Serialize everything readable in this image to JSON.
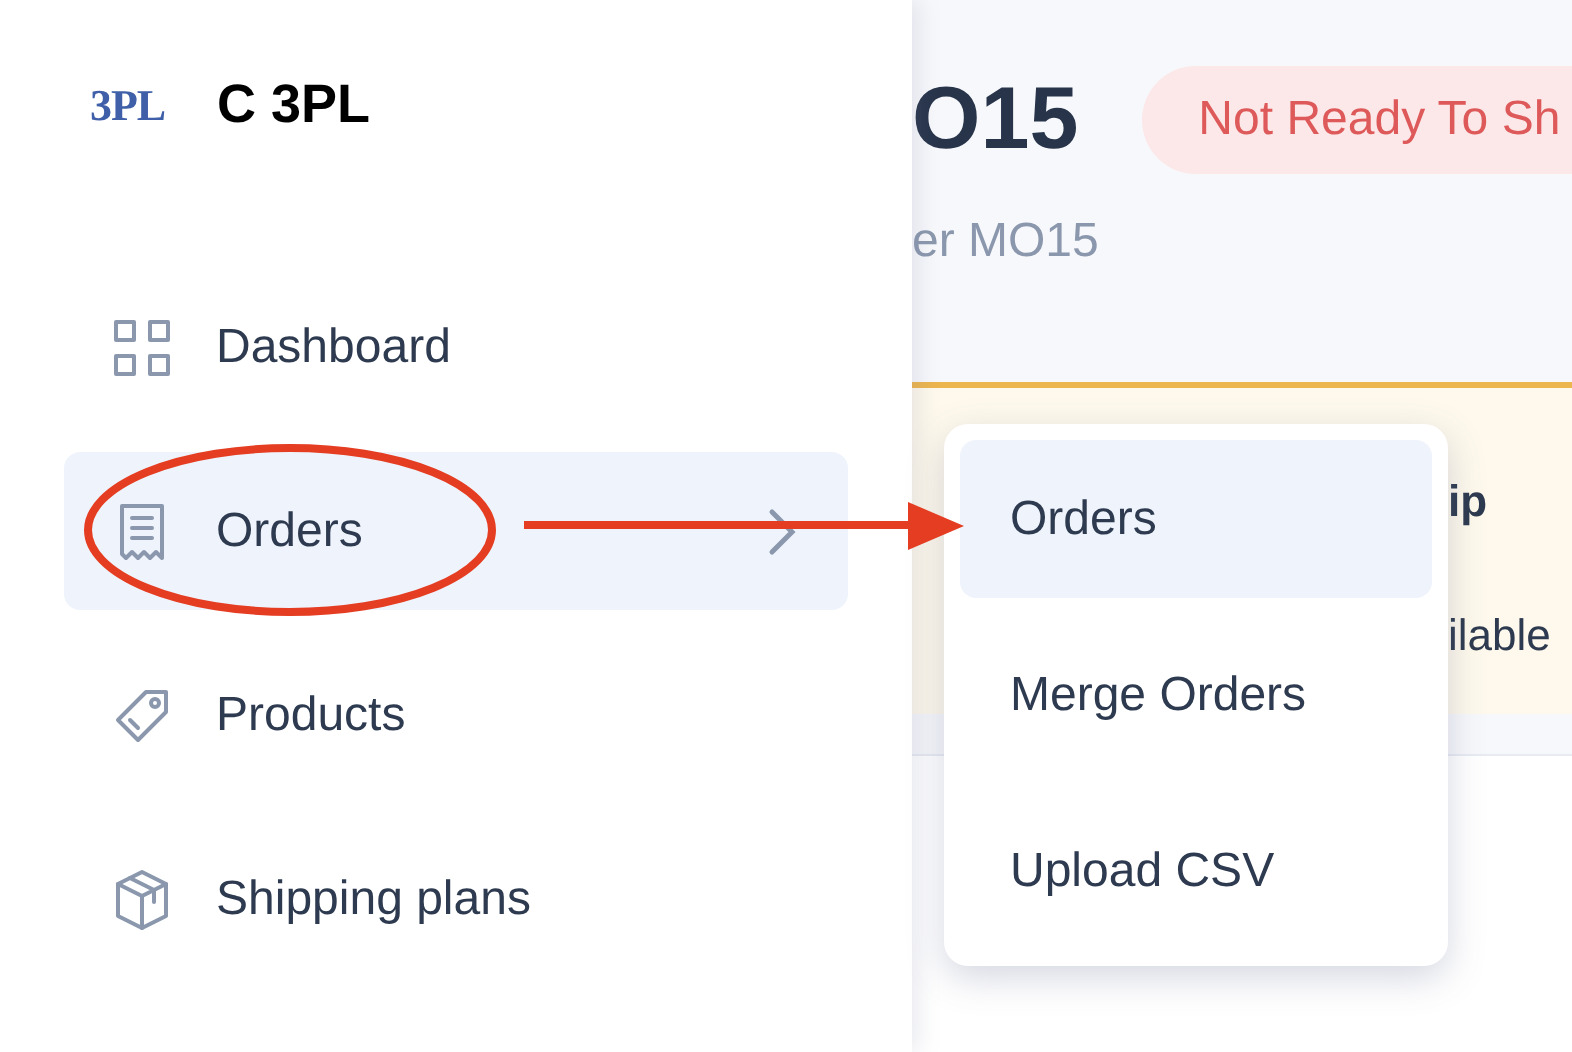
{
  "sidebar": {
    "logo": "3PL",
    "company": "C 3PL",
    "items": [
      {
        "kind": "dashboard",
        "label": "Dashboard",
        "selected": false,
        "has_submenu": false
      },
      {
        "kind": "orders",
        "label": "Orders",
        "selected": true,
        "has_submenu": true
      },
      {
        "kind": "products",
        "label": "Products",
        "selected": false,
        "has_submenu": false
      },
      {
        "kind": "shipping",
        "label": "Shipping plans",
        "selected": false,
        "has_submenu": false
      }
    ]
  },
  "header": {
    "title": "O15",
    "status": "Not Ready To Sh",
    "subtitle": "er MO15"
  },
  "banner": {
    "column_2": {
      "heading": "ip",
      "text": "ilable"
    }
  },
  "submenu": [
    {
      "label": "Orders",
      "selected": true
    },
    {
      "label": "Merge Orders",
      "selected": false
    },
    {
      "label": "Upload CSV",
      "selected": false
    }
  ]
}
